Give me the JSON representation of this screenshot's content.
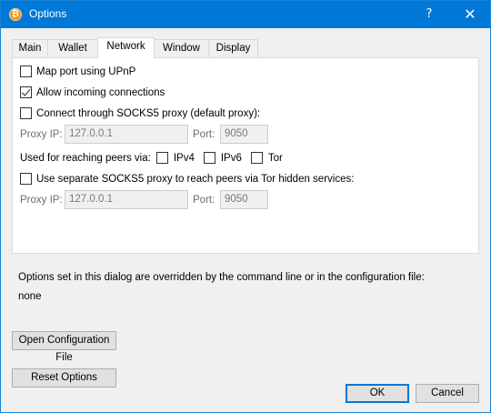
{
  "window": {
    "title": "Options",
    "app_icon": "bitcoin-icon",
    "help_glyph": "?",
    "close_glyph": "✕"
  },
  "tabs": [
    {
      "label": "Main",
      "active": false
    },
    {
      "label": "Wallet",
      "active": false
    },
    {
      "label": "Network",
      "active": true
    },
    {
      "label": "Window",
      "active": false
    },
    {
      "label": "Display",
      "active": false
    }
  ],
  "network": {
    "upnp": {
      "label": "Map port using UPnP",
      "checked": false
    },
    "allow_incoming": {
      "label": "Allow incoming connections",
      "checked": true
    },
    "socks5": {
      "label": "Connect through SOCKS5 proxy (default proxy):",
      "checked": false
    },
    "proxy1": {
      "ip_label": "Proxy IP:",
      "ip_value": "127.0.0.1",
      "port_label": "Port:",
      "port_value": "9050"
    },
    "reach": {
      "label": "Used for reaching peers via:",
      "ipv4": {
        "label": "IPv4",
        "checked": false
      },
      "ipv6": {
        "label": "IPv6",
        "checked": false
      },
      "tor": {
        "label": "Tor",
        "checked": false
      }
    },
    "tor_proxy": {
      "label": "Use separate SOCKS5 proxy to reach peers via Tor hidden services:",
      "checked": false
    },
    "proxy2": {
      "ip_label": "Proxy IP:",
      "ip_value": "127.0.0.1",
      "port_label": "Port:",
      "port_value": "9050"
    }
  },
  "overrides": {
    "text": "Options set in this dialog are overridden by the command line or in the configuration file:",
    "value": "none"
  },
  "buttons": {
    "open_config": "Open Configuration File",
    "reset": "Reset Options",
    "ok": "OK",
    "cancel": "Cancel"
  }
}
